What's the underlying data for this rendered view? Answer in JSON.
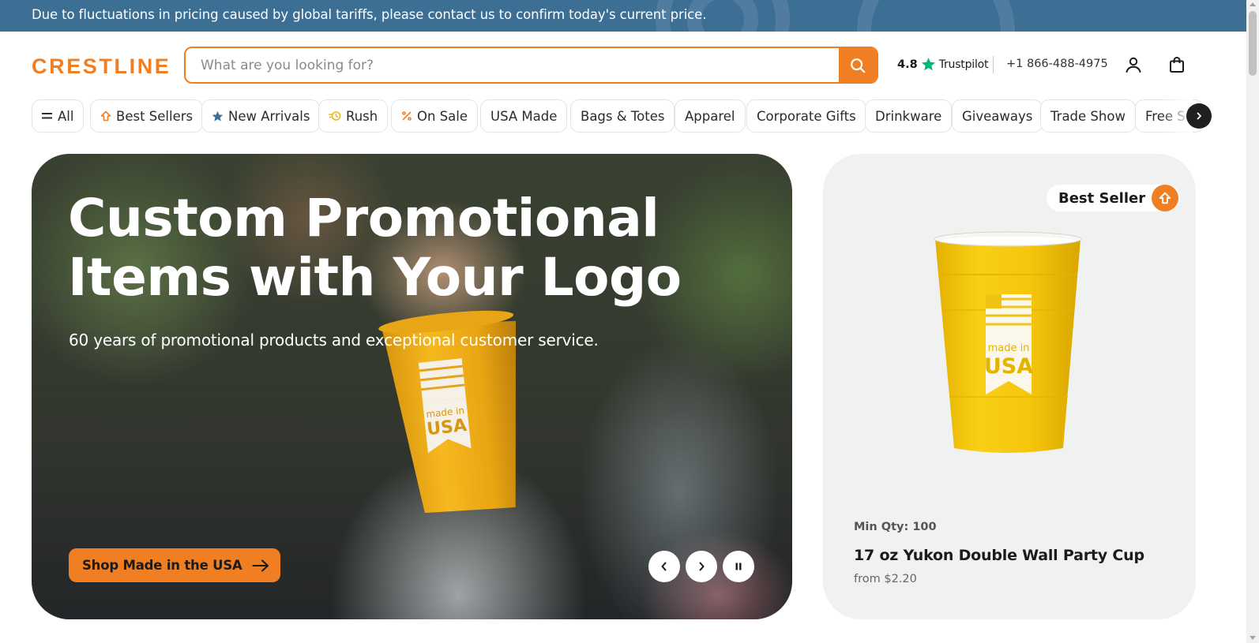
{
  "announcement": {
    "text": "Due to fluctuations in pricing caused by global tariffs, please contact us to confirm today's current price."
  },
  "header": {
    "logo": "CRESTLINE",
    "search": {
      "placeholder": "What are you looking for?"
    },
    "rating": {
      "score": "4.8",
      "provider": "Trustpilot"
    },
    "phone": "+1 866-488-4975",
    "icons": [
      "search-icon",
      "star-icon",
      "account-icon",
      "cart-bag-icon"
    ]
  },
  "categories": [
    {
      "label": "All",
      "icon": "menu-icon"
    },
    {
      "label": "Best Sellers",
      "icon": "arrow-up-house-icon"
    },
    {
      "label": "New Arrivals",
      "icon": "star-icon"
    },
    {
      "label": "Rush",
      "icon": "fast-clock-icon"
    },
    {
      "label": "On Sale",
      "icon": "percent-icon"
    },
    {
      "label": "USA Made",
      "icon": ""
    },
    {
      "label": "Bags & Totes",
      "icon": ""
    },
    {
      "label": "Apparel",
      "icon": ""
    },
    {
      "label": "Corporate Gifts",
      "icon": ""
    },
    {
      "label": "Drinkware",
      "icon": ""
    },
    {
      "label": "Giveaways",
      "icon": ""
    },
    {
      "label": "Trade Show",
      "icon": ""
    },
    {
      "label": "Free Se",
      "icon": ""
    }
  ],
  "hero": {
    "title": "Custom Promotional Items with Your Logo",
    "subtitle": "60 years of promotional products and exceptional customer service.",
    "cta": "Shop Made in the USA",
    "cup_text_1": "made in",
    "cup_text_2": "USA"
  },
  "product": {
    "badge": "Best Seller",
    "min_qty": "Min Qty: 100",
    "name": "17 oz Yukon Double Wall Party Cup",
    "price": "from $2.20",
    "cup_text_1": "made in",
    "cup_text_2": "USA"
  },
  "colors": {
    "brand_orange": "#f07f23",
    "announcement_bg": "#3d6f95",
    "trustpilot_green": "#00b67a",
    "card_bg": "#f0f2f2"
  }
}
